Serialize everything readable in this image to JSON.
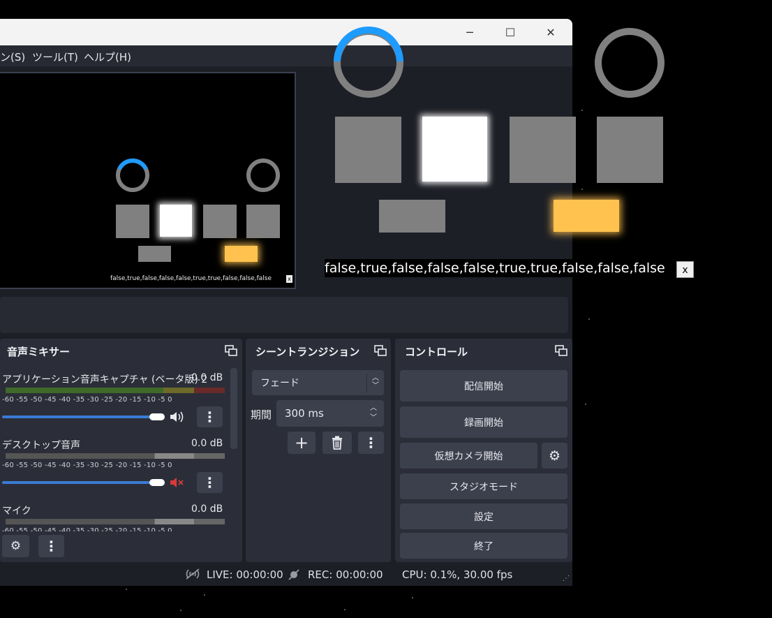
{
  "window": {
    "controls": [
      "─",
      "☐",
      "✕"
    ]
  },
  "menu": {
    "items": [
      "ン(S)",
      "ツール(T)",
      "ヘルプ(H)"
    ]
  },
  "overlay": {
    "text": "false,true,false,false,false,true,true,false,false,false",
    "close_label": "x"
  },
  "preview": {
    "text": "false,true,false,false,false,true,true,false,false,false",
    "close_label": "x"
  },
  "mixer": {
    "title": "音声ミキサー",
    "scale": "-60 -55 -50 -45 -40 -35 -30 -25 -20 -15 -10 -5 0",
    "channels": [
      {
        "name": "アプリケーション音声キャプチャ (ベータ版) 2",
        "db": "0.0 dB",
        "muted": false,
        "level": 1.0
      },
      {
        "name": "デスクトップ音声",
        "db": "0.0 dB",
        "muted": true,
        "level": 1.0
      },
      {
        "name": "マイク",
        "db": "0.0 dB",
        "muted": false,
        "level": 1.0
      }
    ]
  },
  "transitions": {
    "title": "シーントランジション",
    "selected": "フェード",
    "duration_label": "期間",
    "duration_value": "300 ms"
  },
  "controls": {
    "title": "コントロール",
    "start_stream": "配信開始",
    "start_record": "録画開始",
    "virtual_cam": "仮想カメラ開始",
    "studio_mode": "スタジオモード",
    "settings": "設定",
    "exit": "終了"
  },
  "status": {
    "live": "LIVE: 00:00:00",
    "rec": "REC: 00:00:00",
    "cpu": "CPU: 0.1%, 30.00 fps"
  },
  "colors": {
    "accent": "#1e9bff",
    "yellow": "#ffc24f",
    "gray": "#808080",
    "mute_red": "#d9393a"
  }
}
